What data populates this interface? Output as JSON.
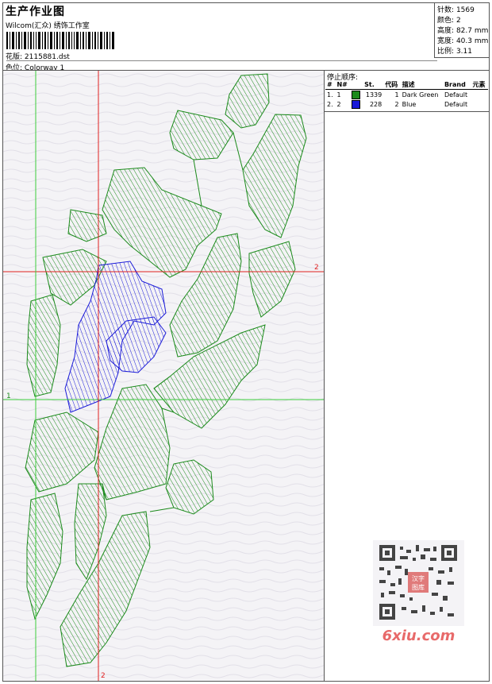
{
  "header": {
    "title": "生产作业图",
    "subtitle": "Wilcom(汇众) 绣饰工作室",
    "design_label": "花版",
    "design_value": "2115881.dst",
    "colorway_label": "色位",
    "colorway_value": "Colorway 1"
  },
  "stats": [
    {
      "label": "针数",
      "value": "1569"
    },
    {
      "label": "颜色",
      "value": "2"
    },
    {
      "label": "高度",
      "value": "82.7 mm"
    },
    {
      "label": "宽度",
      "value": "40.3 mm"
    },
    {
      "label": "比例",
      "value": "3.11"
    }
  ],
  "stop_sequence": {
    "title": "停止顺序:",
    "columns": [
      "#",
      "N#",
      "St.",
      "代码",
      "描述",
      "Brand",
      "元素"
    ],
    "rows": [
      {
        "index": "1.",
        "n": "1",
        "stitches": "1339",
        "code": "1",
        "description": "Dark Green",
        "brand": "Default",
        "color": "#1b8a1b"
      },
      {
        "index": "2.",
        "n": "2",
        "stitches": "228",
        "code": "2",
        "description": "Blue",
        "brand": "Default",
        "color": "#1a1ad8"
      }
    ]
  },
  "axes": {
    "h_red_label": "2",
    "h_green_label": "1",
    "v_red_label": "2"
  },
  "watermark": {
    "text": "6xiu.com",
    "stamp": "汉字图库"
  },
  "colors": {
    "green": "#1b8a1b",
    "blue": "#1a1ad8",
    "red_guide": "#e02020",
    "green_guide": "#3ccc3c"
  }
}
